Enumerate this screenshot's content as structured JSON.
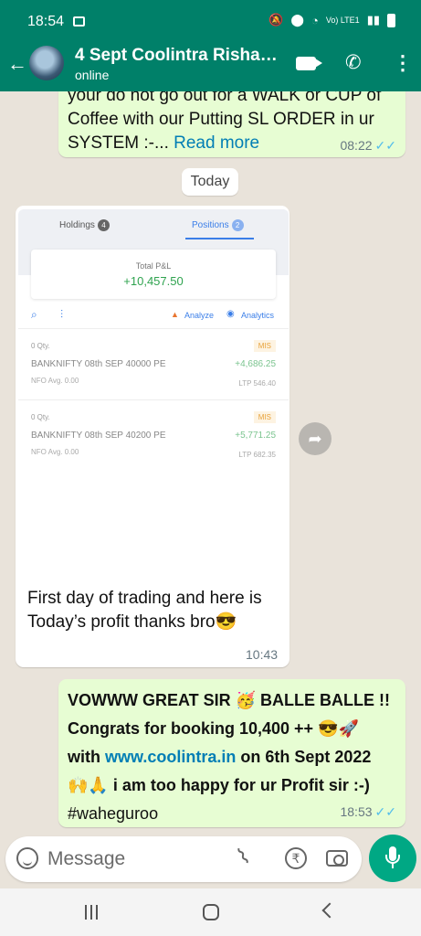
{
  "status_bar": {
    "time": "18:54",
    "network": "Vo) LTE1"
  },
  "header": {
    "contact_name": "4 Sept Coolintra Rishab...",
    "status": "online"
  },
  "messages": {
    "first_out": {
      "line1": "your do not go out for a WALK or CUP of",
      "line2": "Coffee with our Putting SL ORDER in ur",
      "line3_prefix": "SYSTEM :-... ",
      "read_more": "Read more",
      "time": "08:22"
    },
    "day_chip": "Today",
    "incoming": {
      "line1": "First day of trading and here is",
      "line2": "Today’s profit thanks bro😎",
      "time": "10:43"
    },
    "last_out": {
      "line1": "VOWWW GREAT SIR 🥳 BALLE BALLE !!",
      "line2": "Congrats for booking 10,400 ++ 😎🚀",
      "line3_prefix": "with ",
      "line3_link": "www.coolintra.in",
      "line3_suffix": " on 6th Sept 2022",
      "line4": "🙌🙏  i am too happy for ur Profit sir :-)",
      "line5": "#waheguroo",
      "time": "18:53"
    }
  },
  "screenshot": {
    "tabs": [
      {
        "label": "Holdings",
        "count": "4"
      },
      {
        "label": "Positions",
        "count": "2"
      }
    ],
    "total_pnl_label": "Total P&L",
    "total_pnl_value": "+10,457.50",
    "analyze_label": "Analyze",
    "analytics_label": "Analytics",
    "positions": [
      {
        "qty": "0 Qty.",
        "tag": "MIS",
        "symbol": "BANKNIFTY 08th SEP 40000 PE",
        "pnl": "+4,686.25",
        "exchange": "NFO  Avg. 0.00",
        "ltp": "LTP 546.40"
      },
      {
        "qty": "0 Qty.",
        "tag": "MIS",
        "symbol": "BANKNIFTY 08th SEP 40200 PE",
        "pnl": "+5,771.25",
        "exchange": "NFO  Avg. 0.00",
        "ltp": "LTP 682.35"
      }
    ]
  },
  "composer": {
    "placeholder": "Message"
  },
  "colors": {
    "header": "#008069",
    "outgoing_bubble": "#e7fdd3",
    "mic_button": "#00a884",
    "read_tick": "#53bdeb"
  }
}
